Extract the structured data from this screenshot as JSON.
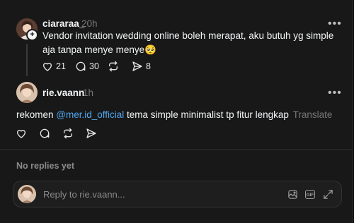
{
  "post": {
    "username": "ciararaa_",
    "time": "20h",
    "text": "Vendor invitation wedding online boleh merapat, aku butuh yg simple aja tanpa menye menye",
    "emoji": "🥺",
    "likes": "21",
    "comments": "30",
    "shares": "8"
  },
  "reply": {
    "username": "rie.vaann",
    "time": "1h",
    "text_before": "rekomen ",
    "mention": "@mer.id_official",
    "text_after": " tema simple minimalist tp fitur lengkap",
    "translate": "Translate"
  },
  "no_replies": "No replies yet",
  "composer": {
    "placeholder": "Reply to rie.vaann...",
    "gif_label": "GIF"
  },
  "colors": {
    "background": "#181818",
    "text": "#f3f5f7",
    "muted": "#777777",
    "mention": "#4ea6ef"
  }
}
